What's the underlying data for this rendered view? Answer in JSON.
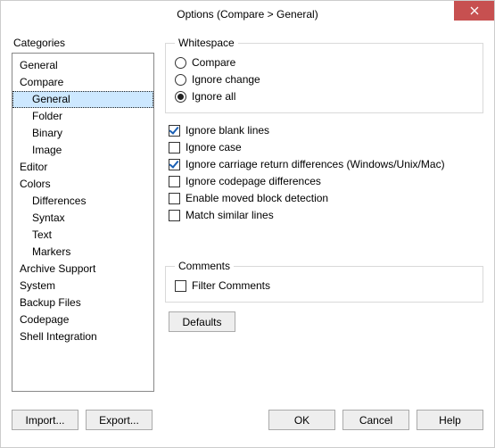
{
  "window": {
    "title": "Options (Compare > General)"
  },
  "categories": {
    "label": "Categories",
    "selected": "General",
    "items": [
      {
        "label": "General",
        "level": 0
      },
      {
        "label": "Compare",
        "level": 0
      },
      {
        "label": "General",
        "level": 1,
        "selected": true
      },
      {
        "label": "Folder",
        "level": 1
      },
      {
        "label": "Binary",
        "level": 1
      },
      {
        "label": "Image",
        "level": 1
      },
      {
        "label": "Editor",
        "level": 0
      },
      {
        "label": "Colors",
        "level": 0
      },
      {
        "label": "Differences",
        "level": 1
      },
      {
        "label": "Syntax",
        "level": 1
      },
      {
        "label": "Text",
        "level": 1
      },
      {
        "label": "Markers",
        "level": 1
      },
      {
        "label": "Archive Support",
        "level": 0
      },
      {
        "label": "System",
        "level": 0
      },
      {
        "label": "Backup Files",
        "level": 0
      },
      {
        "label": "Codepage",
        "level": 0
      },
      {
        "label": "Shell Integration",
        "level": 0
      }
    ]
  },
  "whitespace": {
    "legend": "Whitespace",
    "options": [
      {
        "label": "Compare",
        "checked": false
      },
      {
        "label": "Ignore change",
        "checked": false
      },
      {
        "label": "Ignore all",
        "checked": true
      }
    ]
  },
  "checks": [
    {
      "label": "Ignore blank lines",
      "checked": true
    },
    {
      "label": "Ignore case",
      "checked": false
    },
    {
      "label": "Ignore carriage return differences (Windows/Unix/Mac)",
      "checked": true
    },
    {
      "label": "Ignore codepage differences",
      "checked": false
    },
    {
      "label": "Enable moved block detection",
      "checked": false
    },
    {
      "label": "Match similar lines",
      "checked": false
    }
  ],
  "comments": {
    "legend": "Comments",
    "filter": {
      "label": "Filter Comments",
      "checked": false
    }
  },
  "buttons": {
    "defaults": "Defaults",
    "import": "Import...",
    "export": "Export...",
    "ok": "OK",
    "cancel": "Cancel",
    "help": "Help"
  }
}
